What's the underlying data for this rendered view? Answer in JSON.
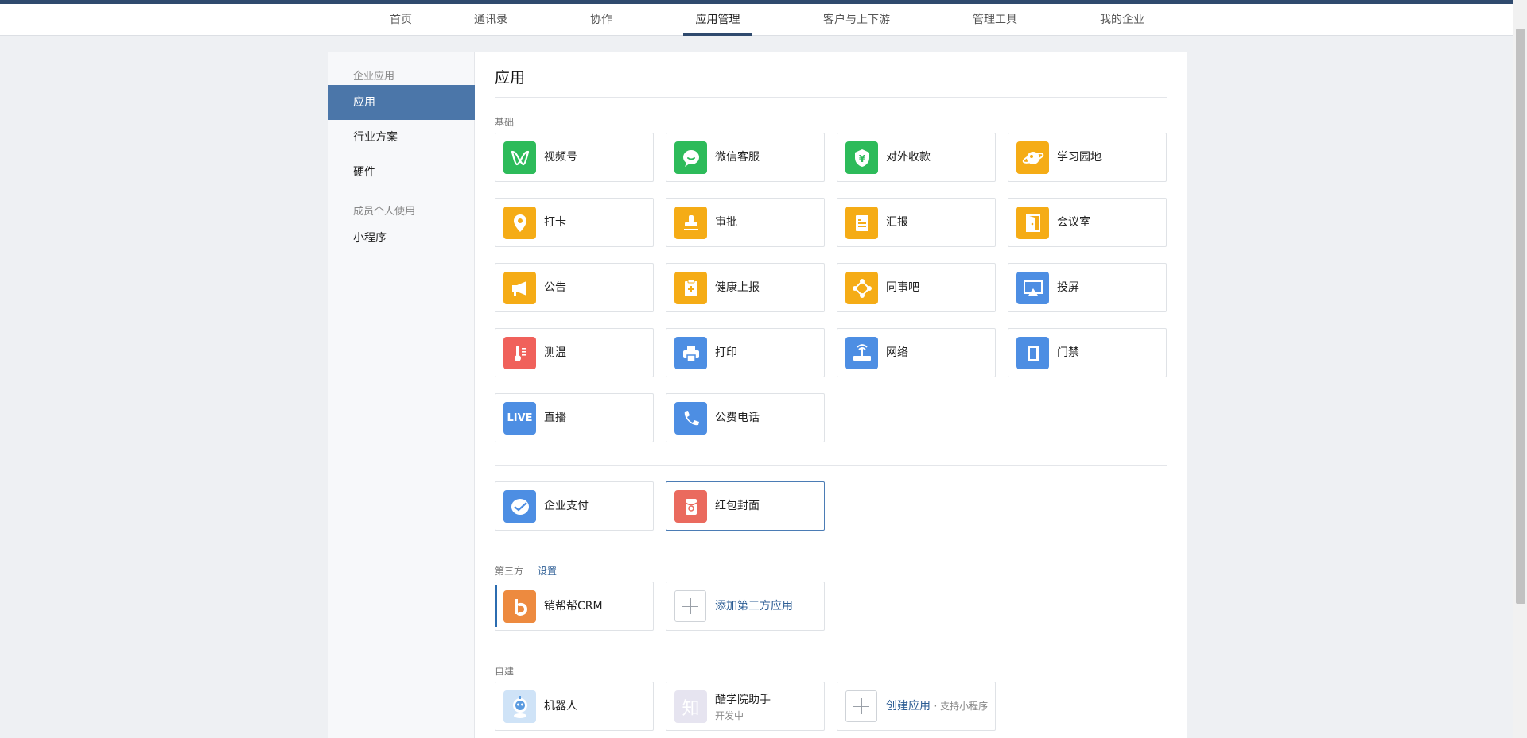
{
  "nav": {
    "items": [
      "首页",
      "通讯录",
      "协作",
      "应用管理",
      "客户与上下游",
      "管理工具",
      "我的企业"
    ],
    "active_index": 3
  },
  "sidebar": {
    "group1": "企业应用",
    "items1": [
      "应用",
      "行业方案",
      "硬件"
    ],
    "active": "应用",
    "group2": "成员个人使用",
    "items2": [
      "小程序"
    ]
  },
  "main": {
    "title": "应用",
    "basic": {
      "label": "基础",
      "apps": [
        {
          "name": "视频号",
          "icon": "video-channel-icon",
          "color": "#2dbb5a"
        },
        {
          "name": "微信客服",
          "icon": "wechat-service-icon",
          "color": "#2dbb5a"
        },
        {
          "name": "对外收款",
          "icon": "payment-shield-icon",
          "color": "#2dbb5a"
        },
        {
          "name": "学习园地",
          "icon": "planet-icon",
          "color": "#f5ac16"
        },
        {
          "name": "打卡",
          "icon": "location-pin-icon",
          "color": "#f5ac16"
        },
        {
          "name": "审批",
          "icon": "stamp-icon",
          "color": "#f5ac16"
        },
        {
          "name": "汇报",
          "icon": "report-doc-icon",
          "color": "#f5ac16"
        },
        {
          "name": "会议室",
          "icon": "door-icon",
          "color": "#f5ac16"
        },
        {
          "name": "公告",
          "icon": "megaphone-icon",
          "color": "#f5ac16"
        },
        {
          "name": "健康上报",
          "icon": "health-clipboard-icon",
          "color": "#f5ac16"
        },
        {
          "name": "同事吧",
          "icon": "network-nodes-icon",
          "color": "#f5ac16"
        },
        {
          "name": "投屏",
          "icon": "screen-cast-icon",
          "color": "#4d8ee3"
        },
        {
          "name": "测温",
          "icon": "thermometer-icon",
          "color": "#f0615b"
        },
        {
          "name": "打印",
          "icon": "printer-icon",
          "color": "#4d8ee3"
        },
        {
          "name": "网络",
          "icon": "router-icon",
          "color": "#4d8ee3"
        },
        {
          "name": "门禁",
          "icon": "access-door-icon",
          "color": "#4d8ee3"
        },
        {
          "name": "直播",
          "icon": "live-icon",
          "color": "#4d8ee3",
          "badge": "LIVE"
        },
        {
          "name": "公费电话",
          "icon": "phone-icon",
          "color": "#4d8ee3"
        }
      ]
    },
    "extra": {
      "apps": [
        {
          "name": "企业支付",
          "icon": "enterprise-pay-icon",
          "color": "#4d8ee3"
        },
        {
          "name": "红包封面",
          "icon": "red-packet-icon",
          "color": "#ea6a5e"
        }
      ]
    },
    "third_party": {
      "label": "第三方",
      "settings_link": "设置",
      "apps": [
        {
          "name": "销帮帮CRM",
          "icon": "crm-b-icon",
          "color": "#ed8a3f"
        }
      ],
      "add_label": "添加第三方应用"
    },
    "custom": {
      "label": "自建",
      "apps": [
        {
          "name": "机器人",
          "icon": "robot-icon",
          "color": "#cfe3f7"
        },
        {
          "name": "酷学院助手",
          "status": "开发中",
          "icon": "zhi-icon",
          "color": "#e6e4f0",
          "badge": "知"
        }
      ],
      "create_label": "创建应用",
      "create_suffix": "· 支持小程序"
    }
  }
}
